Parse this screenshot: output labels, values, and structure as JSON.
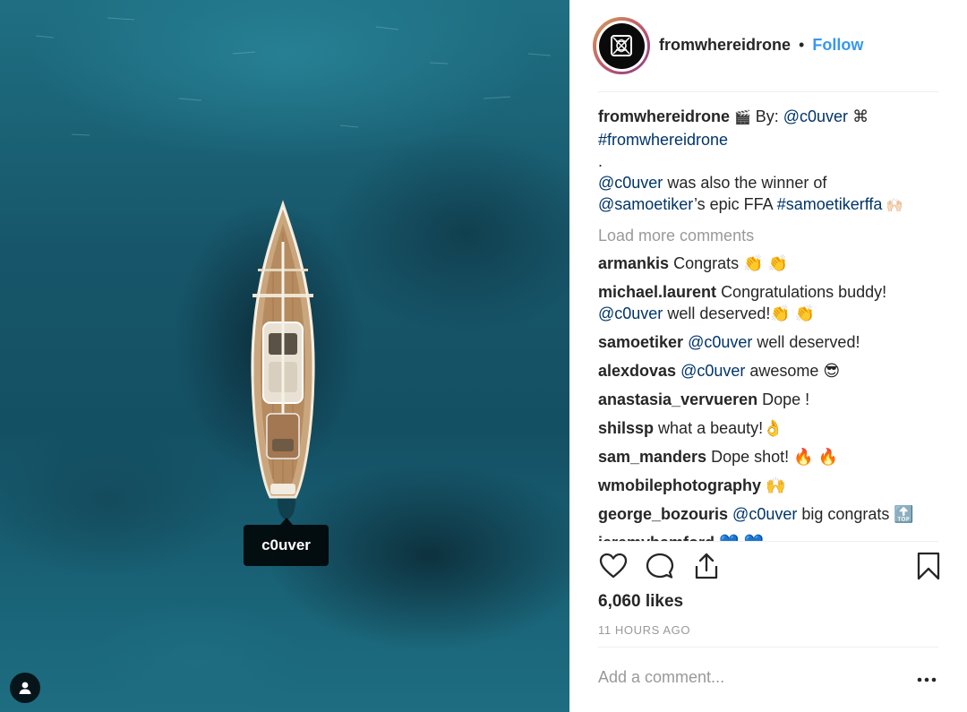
{
  "photo": {
    "tag_label": "c0uver"
  },
  "header": {
    "username": "fromwhereidrone",
    "separator": "•",
    "follow_label": "Follow"
  },
  "caption": {
    "username": "fromwhereidrone",
    "emoji_1": "🎬",
    "text_1": " By: ",
    "mention_1": "@c0uver",
    "symbol": " ⌘",
    "hashtag_1": "#fromwhereidrone",
    "dot_line": ".",
    "mention_2": "@c0uver",
    "text_2": " was also the winner of",
    "mention_3": "@samoetiker",
    "text_3": "’s epic FFA ",
    "hashtag_2": "#samoetikerffa",
    "emoji_2": " 🙌🏻"
  },
  "load_more_label": "Load more comments",
  "comments": [
    {
      "user": "armankis",
      "text": "Congrats 👏 👏"
    },
    {
      "user": "michael.laurent",
      "text": "Congratulations buddy!",
      "mention": "@c0uver",
      "text_after": " well deserved!👏 👏"
    },
    {
      "user": "samoetiker",
      "mention": "@c0uver",
      "text_after": " well deserved!"
    },
    {
      "user": "alexdovas",
      "mention": "@c0uver",
      "text_after": " awesome 😎"
    },
    {
      "user": "anastasia_vervueren",
      "text": "Dope !"
    },
    {
      "user": "shilssp",
      "text": "what a beauty!👌"
    },
    {
      "user": "sam_manders",
      "text": "Dope shot! 🔥 🔥"
    },
    {
      "user": "wmobilephotography",
      "text": "🙌"
    },
    {
      "user": "george_bozouris",
      "mention": "@c0uver",
      "text_after": " big congrats 🔝"
    },
    {
      "user": "jeremybamford",
      "text": "💙 💙"
    }
  ],
  "likes_label": "6,060 likes",
  "timestamp": "11 HOURS AGO",
  "add_comment_placeholder": "Add a comment...",
  "colors": {
    "link": "#003569",
    "follow": "#3897f0",
    "muted": "#999999",
    "text": "#262626"
  },
  "icons": {
    "like": "heart-icon",
    "comment": "comment-bubble-icon",
    "share": "share-icon",
    "save": "bookmark-icon",
    "more": "more-options-icon",
    "tags": "user-tag-icon"
  }
}
